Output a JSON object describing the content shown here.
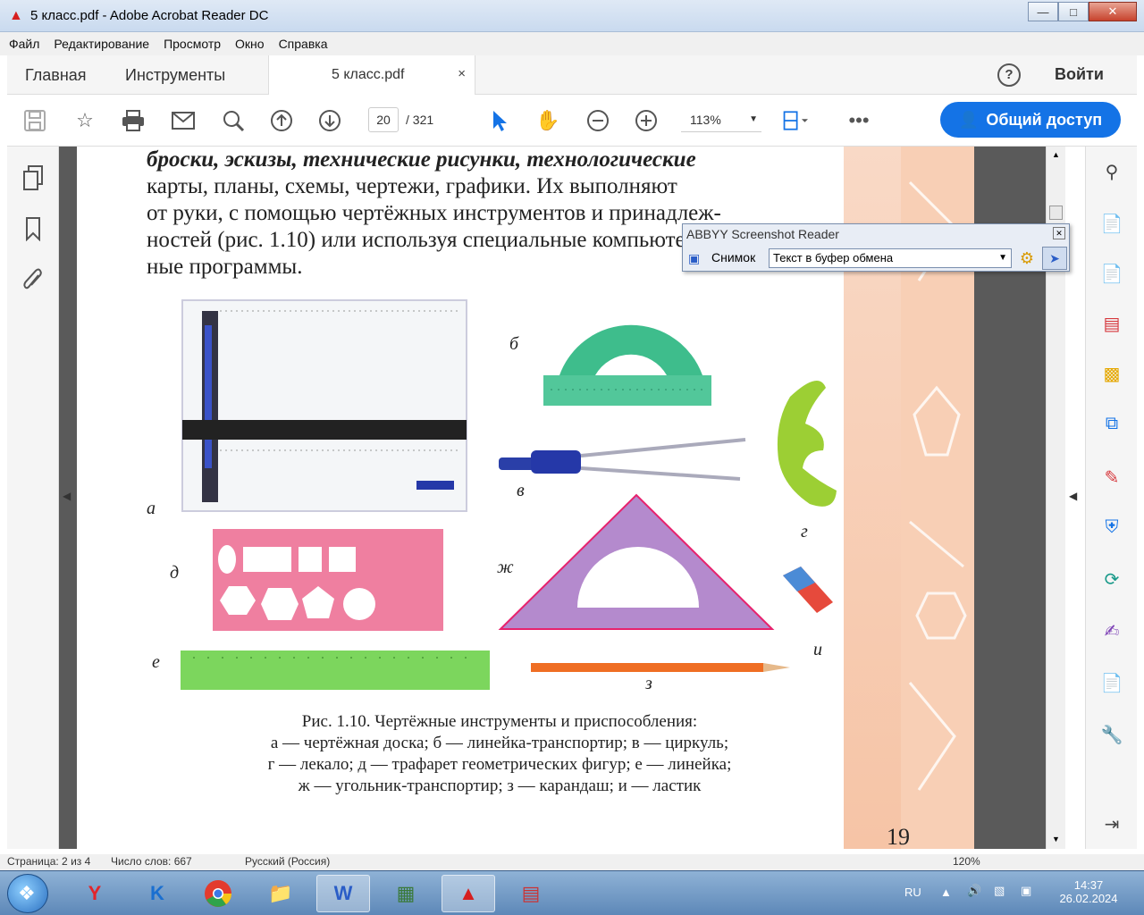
{
  "window": {
    "title": "5 класс.pdf - Adobe Acrobat Reader DC"
  },
  "menu": [
    "Файл",
    "Редактирование",
    "Просмотр",
    "Окно",
    "Справка"
  ],
  "tabs": {
    "home": "Главная",
    "tools": "Инструменты",
    "doc": "5 класс.pdf",
    "close": "×"
  },
  "header": {
    "help": "?",
    "signin": "Войти"
  },
  "toolbar": {
    "page": "20",
    "total": "/ 321",
    "zoom": "113%",
    "share": "Общий доступ"
  },
  "document": {
    "text": [
      "бро­ски, эскизы, технические рисунки, технологические",
      "карты, планы, схемы, чертежи, графики. Их выполняют",
      "от руки, с помощью чертёжных инструментов и принадлеж-",
      "ностей (рис. 1.10) или используя специальные компьютер-",
      "ные программы."
    ],
    "labels": {
      "a": "а",
      "b": "б",
      "v": "в",
      "g": "г",
      "d": "д",
      "e": "е",
      "zh": "ж",
      "z": "з",
      "i": "и"
    },
    "caption": [
      "Рис. 1.10. Чертёжные инструменты и приспособления:",
      "а — чертёжная доска; б — линейка-транспортир; в — циркуль;",
      "г — лекало; д — трафарет геометрических фигур; е — линейка;",
      "ж — угольник-транспортир; з — карандаш; и — ластик"
    ],
    "page_number": "19"
  },
  "abbyy": {
    "title": "ABBYY Screenshot Reader",
    "snap_label": "Снимок",
    "target": "Текст в буфер обмена"
  },
  "statusbar": {
    "page": "Страница: 2 из 4",
    "words": "Число слов: 667",
    "lang": "Русский (Россия)",
    "zoom": "120%"
  },
  "tray": {
    "lang": "RU",
    "time": "14:37",
    "date": "26.02.2024"
  },
  "colors": {
    "accent": "#1473e6",
    "page_deco": "#f8cfb5",
    "rail_red": "#d6373c"
  }
}
